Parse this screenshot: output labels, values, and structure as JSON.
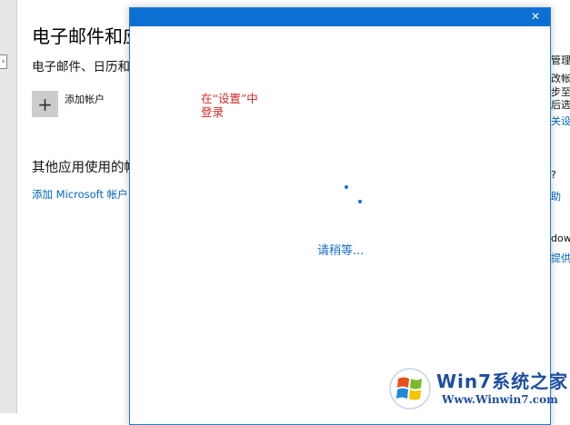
{
  "settings": {
    "title": "电子邮件和应",
    "subtitle": "电子邮件、日历和",
    "add_account_label": "添加帐户",
    "other_apps_heading": "其他应用使用的帐",
    "add_ms_account_link": "添加 Microsoft 帐户"
  },
  "right_column": {
    "lines": [
      "管理",
      "改帐",
      "步至",
      "后选",
      "关设",
      "?",
      "助",
      "dow",
      "提供"
    ]
  },
  "dialog": {
    "close_glyph": "✕",
    "annotation_line1": "在“设置”中",
    "annotation_line2": "登录",
    "wait_text": "请稍等..."
  },
  "watermark": {
    "title": "Win7系统之家",
    "url": "Www.Winwin7.com"
  },
  "colors": {
    "accent_blue": "#0c6fd2",
    "link_blue": "#0067c0",
    "annotation_red": "#d92626"
  }
}
